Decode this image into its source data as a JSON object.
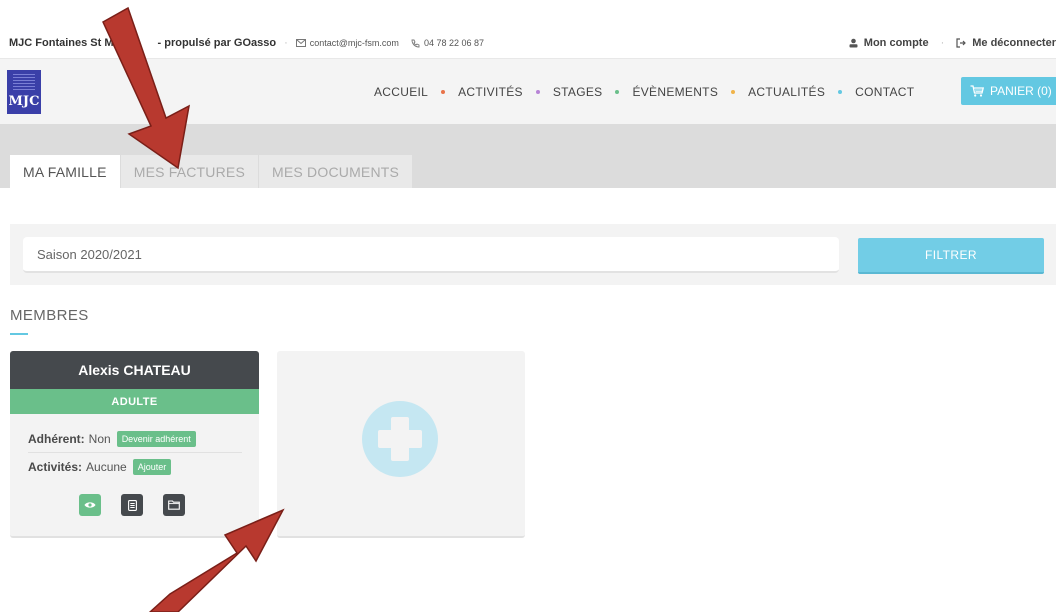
{
  "topbar": {
    "org_prefix": "MJC Fontaines St M",
    "org_suffix": "- propulsé par GOasso",
    "email": "contact@mjc-fsm.com",
    "phone": "04 78 22 06 87",
    "account": "Mon compte",
    "logout": "Me déconnecter"
  },
  "logo": {
    "text": "MJC"
  },
  "nav": {
    "items": [
      {
        "label": "ACCUEIL",
        "dot": "#e8734a"
      },
      {
        "label": "ACTIVITÉS",
        "dot": "#b784d6"
      },
      {
        "label": "STAGES",
        "dot": "#6abf8a"
      },
      {
        "label": "ÉVÈNEMENTS",
        "dot": "#f0b34a"
      },
      {
        "label": "ACTUALITÉS",
        "dot": "#63c8e2"
      },
      {
        "label": "CONTACT",
        "dot": null
      }
    ],
    "cart": "PANIER (0)"
  },
  "tabs": [
    {
      "label": "MA FAMILLE",
      "active": true
    },
    {
      "label": "MES FACTURES",
      "active": false
    },
    {
      "label": "MES DOCUMENTS",
      "active": false
    }
  ],
  "filter": {
    "season_value": "Saison 2020/2021",
    "button": "FILTRER"
  },
  "members": {
    "title": "MEMBRES",
    "card": {
      "name": "Alexis CHATEAU",
      "type": "ADULTE",
      "adherent_label": "Adhérent:",
      "adherent_value": "Non",
      "adherent_action": "Devenir adhérent",
      "activities_label": "Activités:",
      "activities_value": "Aucune",
      "activities_action": "Ajouter"
    }
  },
  "colors": {
    "accent": "#63c8e2",
    "green": "#6abf8a",
    "dark": "#45494d",
    "arrow": "#b8392f"
  }
}
